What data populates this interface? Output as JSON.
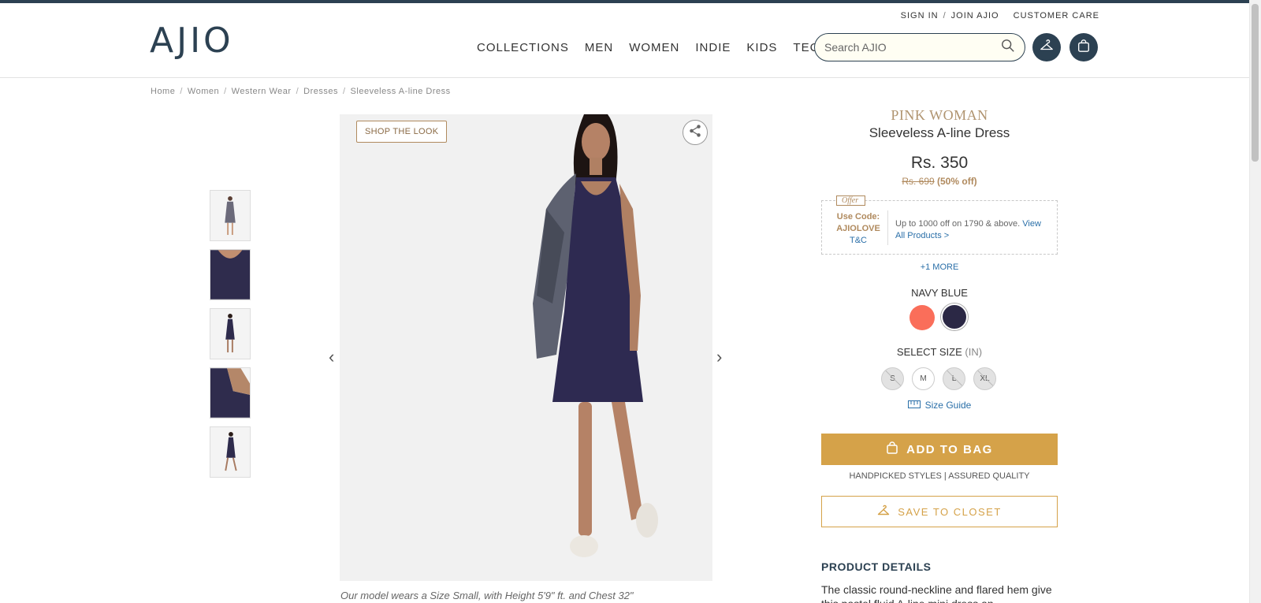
{
  "header": {
    "logo": "AJIO",
    "util": {
      "sign_in": "SIGN IN",
      "sep": "/",
      "join": "JOIN AJIO",
      "customer_care": "CUSTOMER CARE"
    },
    "nav": [
      "COLLECTIONS",
      "MEN",
      "WOMEN",
      "INDIE",
      "KIDS",
      "TECH"
    ],
    "search_placeholder": "Search AJIO"
  },
  "breadcrumb": [
    "Home",
    "Women",
    "Western Wear",
    "Dresses",
    "Sleeveless A-line Dress"
  ],
  "gallery": {
    "shop_the_look": "SHOP THE LOOK",
    "prev_arrow": "‹",
    "next_arrow": "›",
    "caption": "Our model wears a Size Small, with Height 5'9\" ft. and Chest 32\""
  },
  "product": {
    "brand": "PINK WOMAN",
    "name": "Sleeveless A-line Dress",
    "price": "Rs. 350",
    "mrp": "Rs. 699",
    "discount": "(50% off)"
  },
  "offer": {
    "tag": "Offer",
    "use_code_label": "Use Code:",
    "code": "AJIOLOVE",
    "tc": "T&C",
    "desc": "Up to 1000 off on 1790 & above.",
    "link": "View All Products >",
    "more": "+1 MORE"
  },
  "color": {
    "selected": "NAVY BLUE",
    "swatches": [
      "#fa6e5a",
      "#2b2845"
    ]
  },
  "size": {
    "label": "SELECT SIZE",
    "unit": "(IN)",
    "options": [
      "S",
      "M",
      "L",
      "XL"
    ],
    "guide": "Size Guide"
  },
  "actions": {
    "add_to_bag": "ADD TO BAG",
    "assured": "HANDPICKED STYLES | ASSURED QUALITY",
    "save_to_closet": "SAVE TO CLOSET"
  },
  "details": {
    "title": "PRODUCT DETAILS",
    "text": "The classic round-neckline and flared hem give this pastel fluid A-line mini dress an understated, chic"
  },
  "colors": {
    "brand_navy": "#2c4152",
    "gold": "#d5a249",
    "link": "#2a6fa8"
  }
}
